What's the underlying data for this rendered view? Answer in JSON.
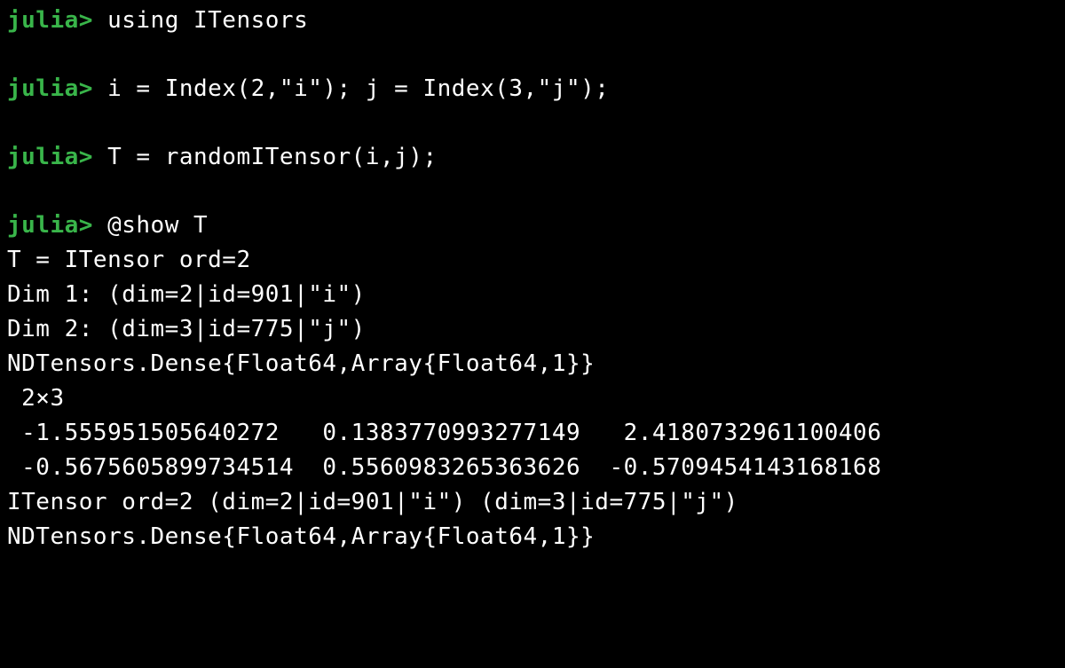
{
  "prompt": "julia>",
  "commands": [
    {
      "input": "using ITensors",
      "output": []
    },
    {
      "input": "i = Index(2,\"i\"); j = Index(3,\"j\");",
      "output": []
    },
    {
      "input": "T = randomITensor(i,j);",
      "output": []
    },
    {
      "input": "@show T",
      "output": [
        "T = ITensor ord=2",
        "Dim 1: (dim=2|id=901|\"i\")",
        "Dim 2: (dim=3|id=775|\"j\")",
        "NDTensors.Dense{Float64,Array{Float64,1}}",
        " 2×3",
        " -1.555951505640272   0.1383770993277149   2.4180732961100406",
        " -0.5675605899734514  0.5560983265363626  -0.5709454143168168",
        "ITensor ord=2 (dim=2|id=901|\"i\") (dim=3|id=775|\"j\")",
        "NDTensors.Dense{Float64,Array{Float64,1}}"
      ]
    }
  ],
  "chart_data": {
    "type": "table",
    "title": "ITensor T values (2×3)",
    "rows": [
      [
        -1.555951505640272,
        0.1383770993277149,
        2.4180732961100406
      ],
      [
        -0.5675605899734514,
        0.5560983265363626,
        -0.5709454143168168
      ]
    ],
    "dims": [
      {
        "name": "i",
        "size": 2,
        "id": 901
      },
      {
        "name": "j",
        "size": 3,
        "id": 775
      }
    ],
    "storage": "NDTensors.Dense{Float64,Array{Float64,1}}"
  }
}
